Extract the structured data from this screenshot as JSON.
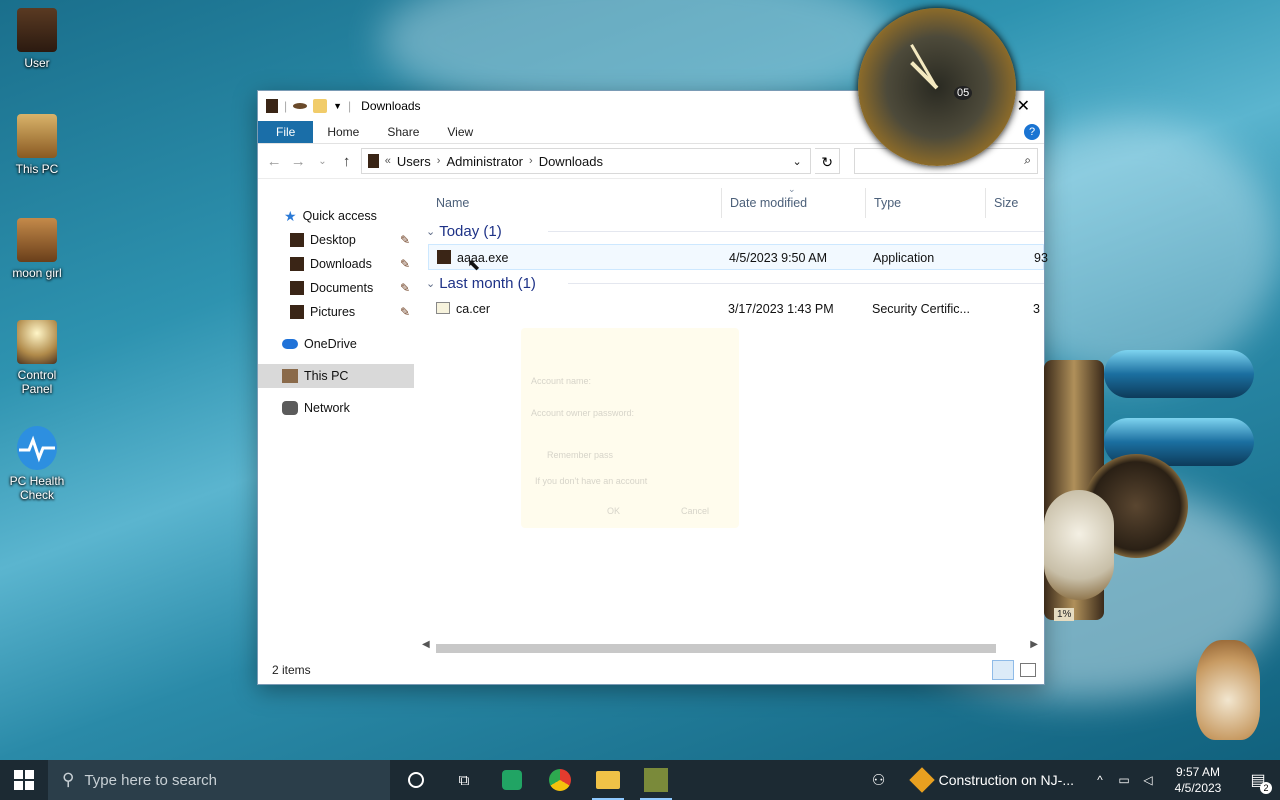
{
  "desktop": {
    "icons": [
      {
        "label": "User"
      },
      {
        "label": "This PC"
      },
      {
        "label": "moon girl"
      },
      {
        "label": "Control Panel"
      },
      {
        "label": "PC Health Check"
      }
    ]
  },
  "window": {
    "title": "Downloads",
    "ribbon": {
      "file": "File",
      "home": "Home",
      "share": "Share",
      "view": "View"
    },
    "address": {
      "overflow": "«",
      "crumbs": [
        "Users",
        "Administrator",
        "Downloads"
      ],
      "search_placeholder": ""
    },
    "sidebar": {
      "quick_access": "Quick access",
      "pinned": [
        {
          "label": "Desktop"
        },
        {
          "label": "Downloads"
        },
        {
          "label": "Documents"
        },
        {
          "label": "Pictures"
        }
      ],
      "onedrive": "OneDrive",
      "this_pc": "This PC",
      "network": "Network"
    },
    "columns": {
      "name": "Name",
      "date": "Date modified",
      "type": "Type",
      "size": "Size"
    },
    "groups": [
      {
        "label": "Today (1)",
        "files": [
          {
            "name": "aaaa.exe",
            "date": "4/5/2023 9:50 AM",
            "type": "Application",
            "size": "93"
          }
        ]
      },
      {
        "label": "Last month (1)",
        "files": [
          {
            "name": "ca.cer",
            "date": "3/17/2023 1:43 PM",
            "type": "Security Certific...",
            "size": "3"
          }
        ]
      }
    ],
    "status": "2 items"
  },
  "ghost_dialog": {
    "account_name": "Account name:",
    "password": "Account owner password:",
    "remember": "Remember pass",
    "no_account": "If you don't have an account",
    "ok": "OK",
    "cancel": "Cancel"
  },
  "widgets": {
    "clock_date": "05",
    "gauge_percent": "1%"
  },
  "taskbar": {
    "search_placeholder": "Type here to search",
    "notification": "Construction on NJ-...",
    "time": "9:57 AM",
    "date": "4/5/2023",
    "notification_count": "2"
  },
  "colors": {
    "accent": "#1a6ea8",
    "group_header": "#1e3287",
    "taskbar": "#1c2a33"
  }
}
